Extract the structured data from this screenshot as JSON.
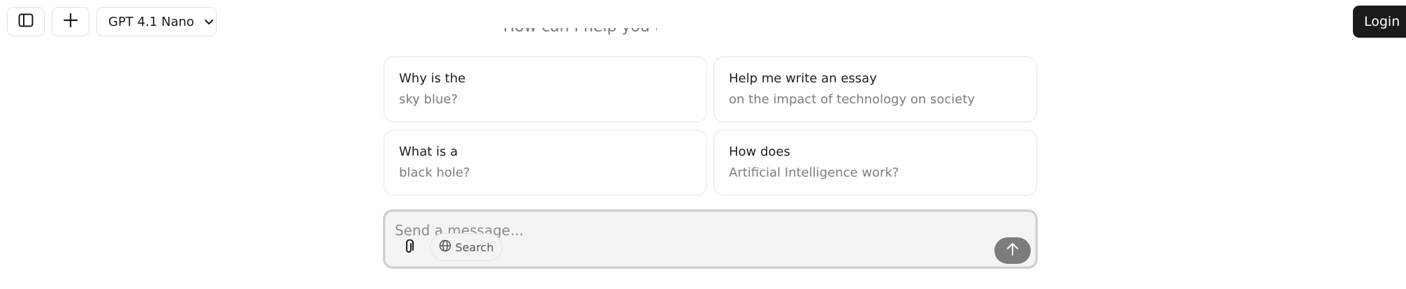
{
  "topbar": {
    "model_label": "GPT 4.1 Nano",
    "login_label": "Login"
  },
  "partial_heading": "How can I help you today?",
  "suggestions": [
    {
      "title": "Why is the",
      "subtitle": "sky blue?"
    },
    {
      "title": "Help me write an essay",
      "subtitle": "on the impact of technology on society"
    },
    {
      "title": "What is a",
      "subtitle": "black hole?"
    },
    {
      "title": "How does",
      "subtitle": "Artificial Intelligence work?"
    }
  ],
  "composer": {
    "placeholder": "Send a message...",
    "search_label": "Search"
  },
  "icons": {
    "sidebar": "sidebar-toggle-icon",
    "new_chat": "plus-icon",
    "model_dropdown": "chevron-down-icon",
    "attach": "paperclip-icon",
    "search": "globe-icon",
    "send": "arrow-up-icon"
  },
  "colors": {
    "login_bg": "#1b1b1b",
    "send_bg": "#7c7c7c",
    "composer_bg": "#f4f4f4"
  }
}
